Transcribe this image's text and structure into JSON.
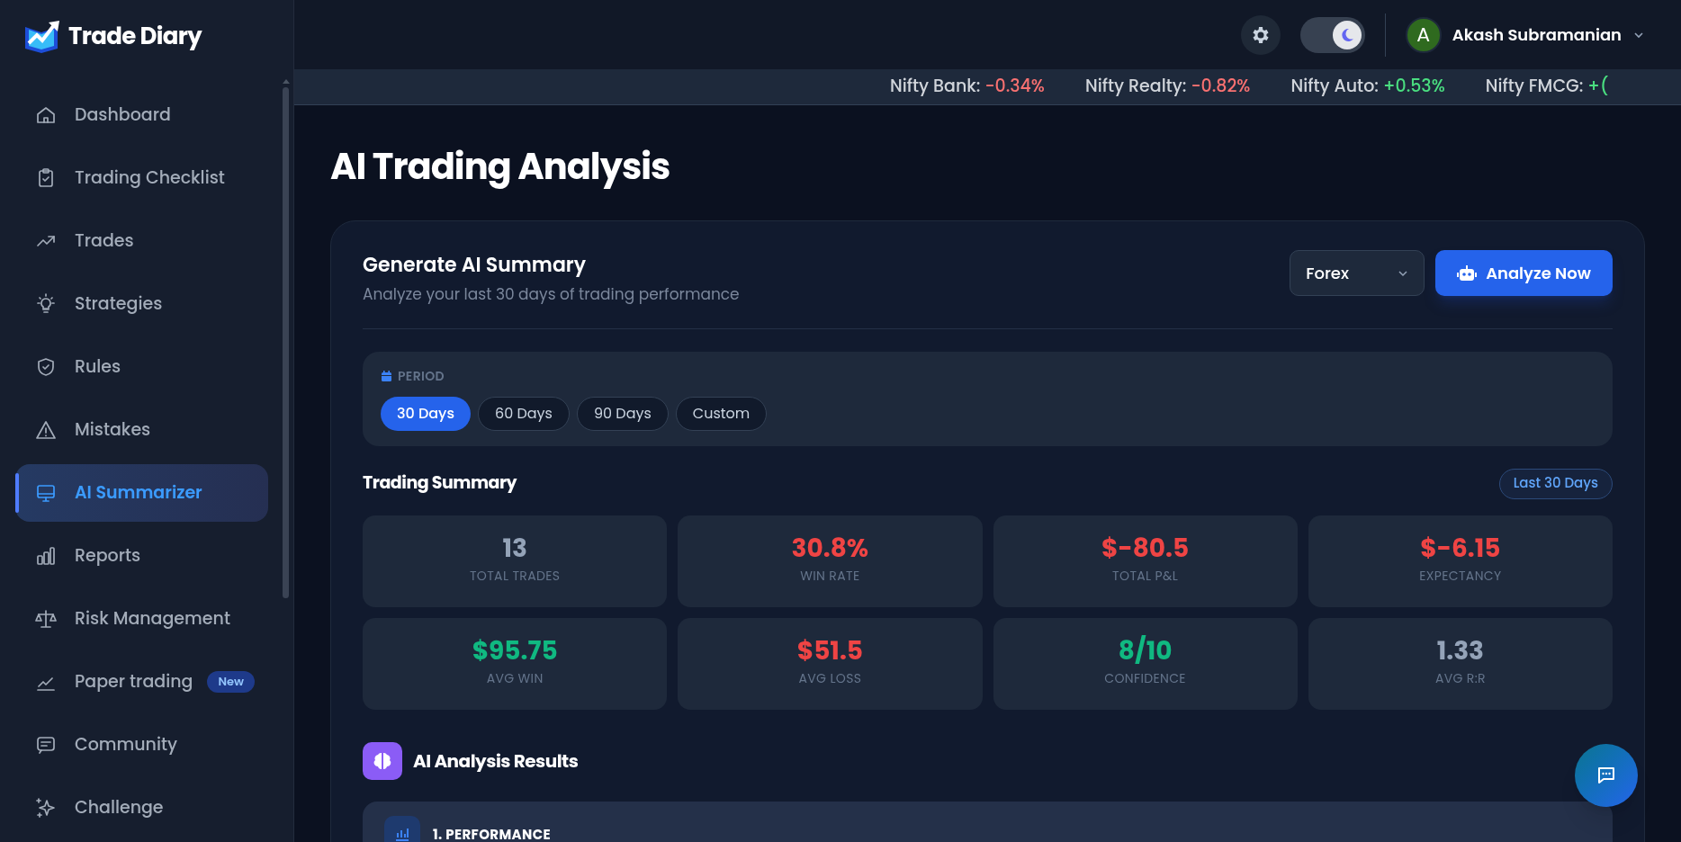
{
  "brand": {
    "name": "Trade Diary"
  },
  "sidebar": {
    "items": [
      {
        "label": "Dashboard",
        "selected": false
      },
      {
        "label": "Trading Checklist",
        "selected": false
      },
      {
        "label": "Trades",
        "selected": false
      },
      {
        "label": "Strategies",
        "selected": false
      },
      {
        "label": "Rules",
        "selected": false
      },
      {
        "label": "Mistakes",
        "selected": false
      },
      {
        "label": "AI Summarizer",
        "selected": true
      },
      {
        "label": "Reports",
        "selected": false
      },
      {
        "label": "Risk Management",
        "selected": false
      },
      {
        "label": "Paper trading",
        "selected": false,
        "badge": "New"
      },
      {
        "label": "Community",
        "selected": false
      },
      {
        "label": "Challenge",
        "selected": false
      }
    ]
  },
  "header": {
    "dark_mode": true,
    "user": {
      "initial": "A",
      "name": "Akash Subramanian"
    }
  },
  "ticker": [
    {
      "name": "Nifty Bank:",
      "change": "-0.34%",
      "color": "#f87171"
    },
    {
      "name": "Nifty Realty:",
      "change": "-0.82%",
      "color": "#f87171"
    },
    {
      "name": "Nifty Auto:",
      "change": "+0.53%",
      "color": "#4ade80"
    },
    {
      "name": "Nifty FMCG:",
      "change": "+(",
      "color": "#4ade80"
    }
  ],
  "page_title": "AI Trading Analysis",
  "summary_card": {
    "title": "Generate AI Summary",
    "subtitle": "Analyze your last 30 days of trading performance",
    "market_select": {
      "value": "Forex"
    },
    "analyze_button": "Analyze Now",
    "period": {
      "label": "PERIOD",
      "options": [
        {
          "label": "30 Days",
          "selected": true
        },
        {
          "label": "60 Days",
          "selected": false
        },
        {
          "label": "90 Days",
          "selected": false
        },
        {
          "label": "Custom",
          "selected": false
        }
      ]
    },
    "trading_summary": {
      "title": "Trading Summary",
      "badge": "Last 30 Days",
      "stats": [
        {
          "value": "13",
          "label": "TOTAL TRADES",
          "color": "#94a3b8"
        },
        {
          "value": "30.8%",
          "label": "WIN RATE",
          "color": "#ef4444"
        },
        {
          "value": "$-80.5",
          "label": "TOTAL P&L",
          "color": "#ef4444"
        },
        {
          "value": "$-6.15",
          "label": "EXPECTANCY",
          "color": "#ef4444"
        },
        {
          "value": "$95.75",
          "label": "AVG WIN",
          "color": "#10b981"
        },
        {
          "value": "$51.5",
          "label": "AVG LOSS",
          "color": "#ef4444"
        },
        {
          "value": "8/10",
          "label": "CONFIDENCE",
          "color": "#10b981"
        },
        {
          "value": "1.33",
          "label": "AVG R:R",
          "color": "#94a3b8"
        }
      ]
    },
    "results": {
      "title": "AI Analysis Results",
      "sections": [
        {
          "title": "1. PERFORMANCE"
        }
      ]
    }
  }
}
